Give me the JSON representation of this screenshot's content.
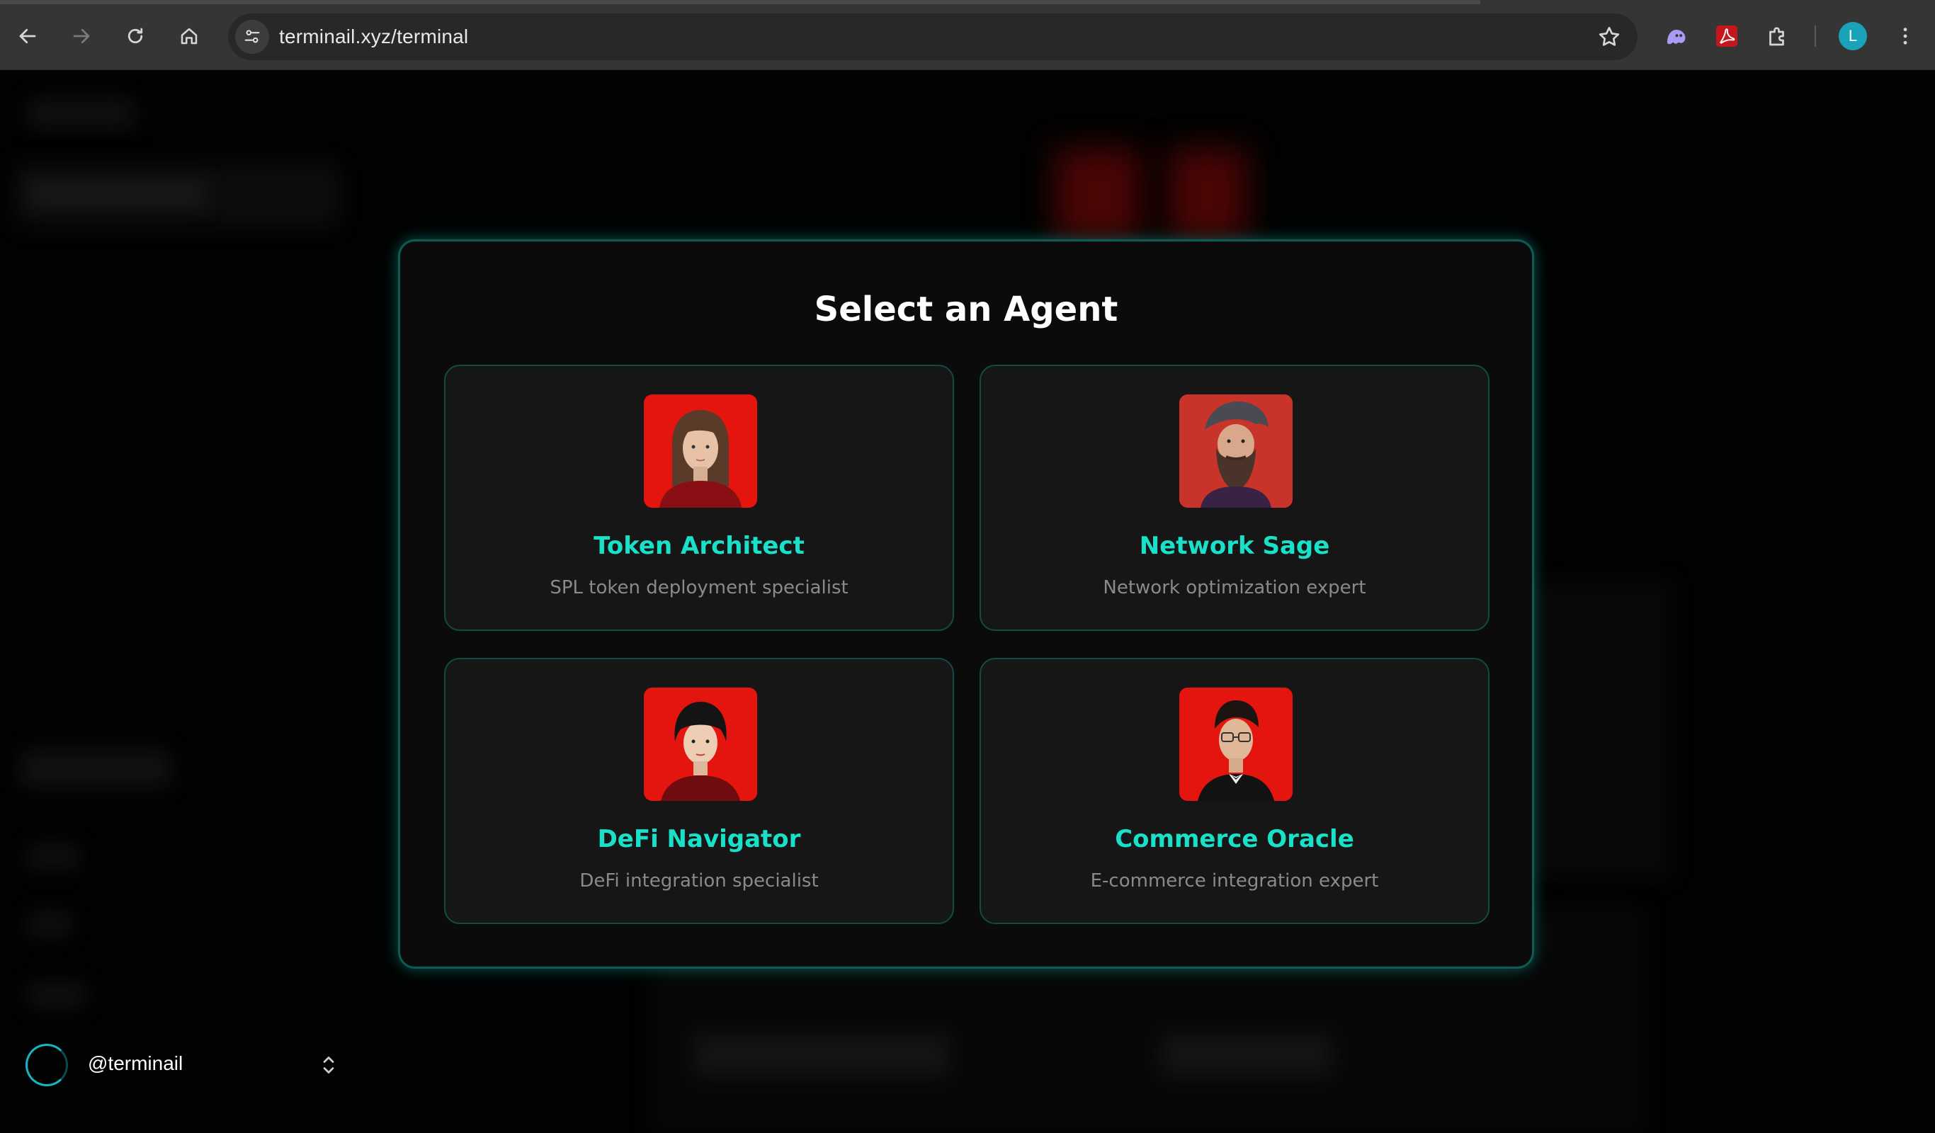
{
  "browser": {
    "url": "terminail.xyz/terminal",
    "profile_initial": "L",
    "icons": {
      "back": "back-arrow-icon",
      "forward": "forward-arrow-icon",
      "reload": "reload-icon",
      "home": "home-icon",
      "site_info": "tune-icon",
      "bookmark": "star-icon",
      "ext_ghost": "ghost-extension-icon",
      "ext_pdf": "pdf-extension-icon",
      "extensions": "puzzle-icon",
      "menu": "kebab-menu-icon"
    }
  },
  "sidebar": {
    "username": "@terminail",
    "switcher_icon": "chevron-updown-icon"
  },
  "modal": {
    "title": "Select an Agent",
    "agents": [
      {
        "name": "Token Architect",
        "description": "SPL token deployment specialist",
        "avatar": "woman-portrait"
      },
      {
        "name": "Network Sage",
        "description": "Network optimization expert",
        "avatar": "bearded-man-portrait"
      },
      {
        "name": "DeFi Navigator",
        "description": "DeFi integration specialist",
        "avatar": "woman-portrait"
      },
      {
        "name": "Commerce Oracle",
        "description": "E-commerce integration expert",
        "avatar": "man-with-glasses-portrait"
      }
    ]
  },
  "colors": {
    "accent": "#19e0c8",
    "modal_border": "#0f5a54",
    "avatar_bg": "#e01010",
    "card_bg": "#161616",
    "description_text": "#8a8a8a"
  }
}
